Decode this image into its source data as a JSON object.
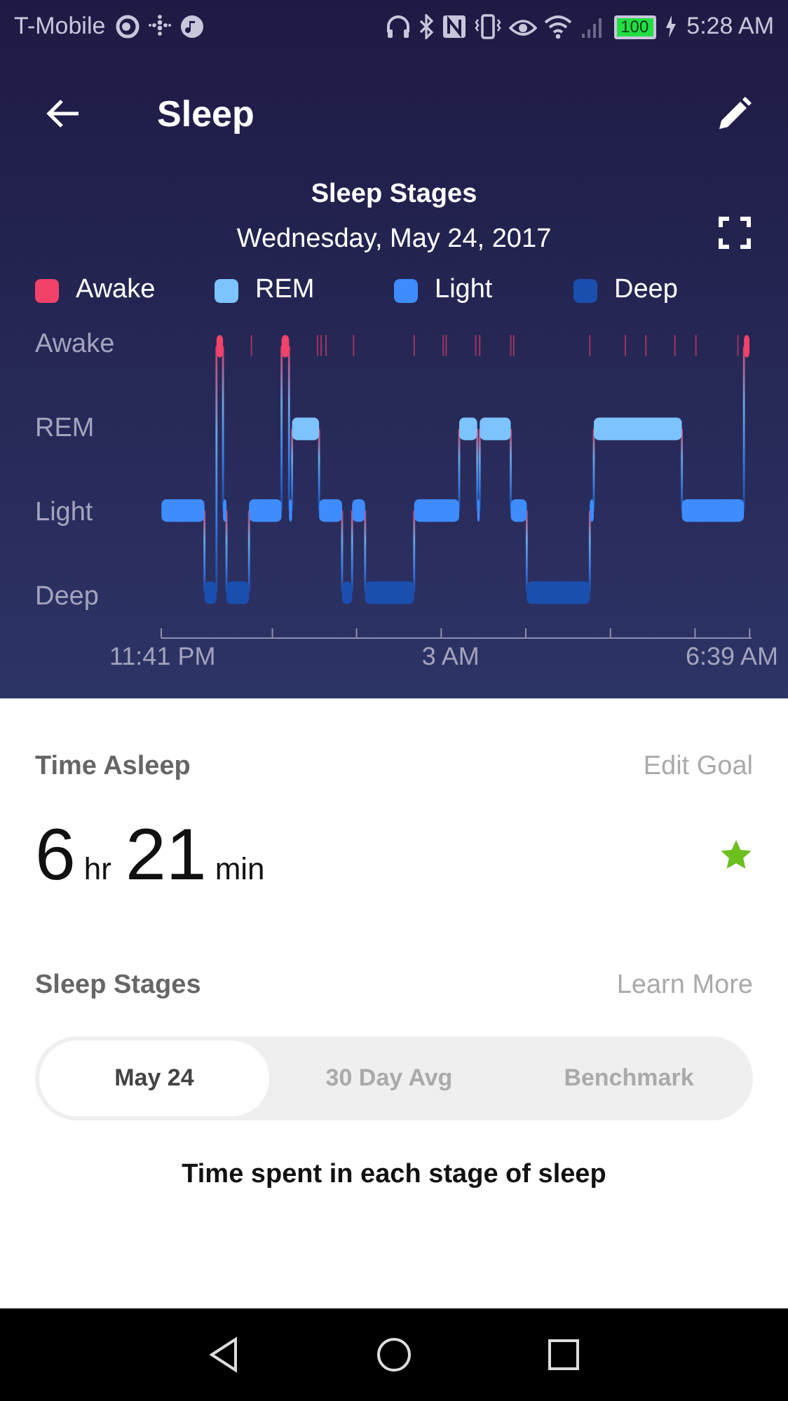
{
  "status_bar": {
    "carrier": "T-Mobile",
    "battery": "100",
    "time": "5:28 AM"
  },
  "header": {
    "title": "Sleep"
  },
  "sleep_chart": {
    "title": "Sleep Stages",
    "date": "Wednesday, May 24, 2017",
    "legend": [
      {
        "label": "Awake",
        "color": "#f2426a"
      },
      {
        "label": "REM",
        "color": "#7cc3ff"
      },
      {
        "label": "Light",
        "color": "#3f8cff"
      },
      {
        "label": "Deep",
        "color": "#1a4fb0"
      }
    ],
    "y_labels": [
      "Awake",
      "REM",
      "Light",
      "Deep"
    ],
    "x_labels": [
      "11:41 PM",
      "3 AM",
      "6:39 AM"
    ]
  },
  "time_asleep": {
    "heading": "Time Asleep",
    "action": "Edit Goal",
    "hours": "6",
    "hours_unit": "hr",
    "minutes": "21",
    "minutes_unit": "min",
    "goal_met": true
  },
  "sleep_stages": {
    "heading": "Sleep Stages",
    "action": "Learn More",
    "tabs": [
      {
        "label": "May 24",
        "selected": true
      },
      {
        "label": "30 Day Avg",
        "selected": false
      },
      {
        "label": "Benchmark",
        "selected": false
      }
    ],
    "caption": "Time spent in each stage of sleep"
  }
}
